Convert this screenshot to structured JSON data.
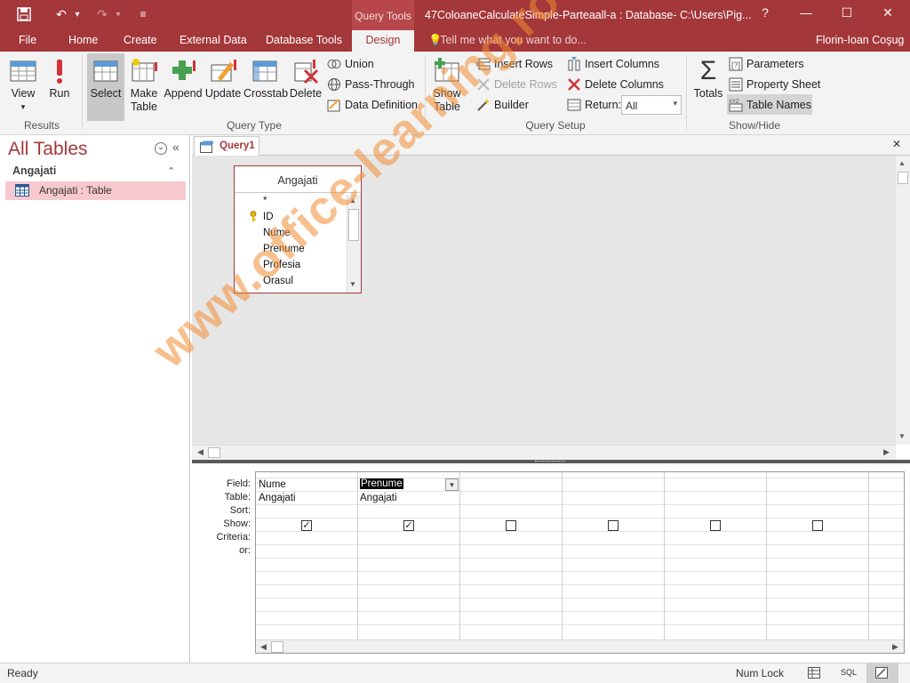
{
  "titlebar": {
    "context_tab": "Query Tools",
    "title": "47ColoaneCalculateSimple-Parteaall-a : Database- C:\\Users\\Pig...",
    "help": "?",
    "minimize": "—",
    "maximize": "☐",
    "close": "✕",
    "save_glyph": "💾",
    "undo_glyph": "↶",
    "redo_glyph": "↷",
    "dropdown_glyph": "▾",
    "customize_glyph": "≡"
  },
  "tabs": {
    "file": "File",
    "home": "Home",
    "create": "Create",
    "external": "External Data",
    "dbtools": "Database Tools",
    "design": "Design",
    "tellme": "Tell me what you want to do...",
    "user": "Florin-Ioan Coşug"
  },
  "ribbon": {
    "results": {
      "label": "Results",
      "view": "View",
      "run": "Run"
    },
    "query_type": {
      "label": "Query Type",
      "select": "Select",
      "make_table": "Make",
      "make_table_2": "Table",
      "append": "Append",
      "update": "Update",
      "crosstab": "Crosstab",
      "delete": "Delete",
      "union": "Union",
      "pass_through": "Pass-Through",
      "data_definition": "Data Definition"
    },
    "query_setup": {
      "label": "Query Setup",
      "show_table": "Show",
      "show_table_2": "Table",
      "insert_rows": "Insert Rows",
      "delete_rows": "Delete Rows",
      "builder": "Builder",
      "insert_columns": "Insert Columns",
      "delete_columns": "Delete Columns",
      "return_label": "Return:",
      "return_value": "All"
    },
    "show_hide": {
      "label": "Show/Hide",
      "totals": "Totals",
      "parameters": "Parameters",
      "property_sheet": "Property Sheet",
      "table_names": "Table Names"
    }
  },
  "nav": {
    "title": "All Tables",
    "group": "Angajati",
    "item": "Angajati : Table",
    "menu_glyph": "⌄",
    "collapse_glyph": "«",
    "group_glyph": "⌃"
  },
  "doc": {
    "tab_label": "Query1",
    "close_glyph": "✕"
  },
  "table_box": {
    "title": "Angajati",
    "fields": [
      "*",
      "ID",
      "Nume",
      "Prenume",
      "Profesia",
      "Orasul"
    ]
  },
  "grid": {
    "row_labels": [
      "Field:",
      "Table:",
      "Sort:",
      "Show:",
      "Criteria:",
      "or:"
    ],
    "columns": [
      {
        "field": "Nume",
        "table": "Angajati",
        "show": true
      },
      {
        "field": "Prenume",
        "table": "Angajati",
        "show": true
      },
      {
        "field": "",
        "table": "",
        "show": false
      },
      {
        "field": "",
        "table": "",
        "show": false
      },
      {
        "field": "",
        "table": "",
        "show": false
      },
      {
        "field": "",
        "table": "",
        "show": false
      }
    ],
    "check_glyph": "✓"
  },
  "status": {
    "ready": "Ready",
    "num_lock": "Num Lock",
    "sql": "SQL"
  },
  "watermark": "www.office-learning.ro",
  "colors": {
    "accent": "#a4373a",
    "selected_item": "#f7c9ce"
  }
}
